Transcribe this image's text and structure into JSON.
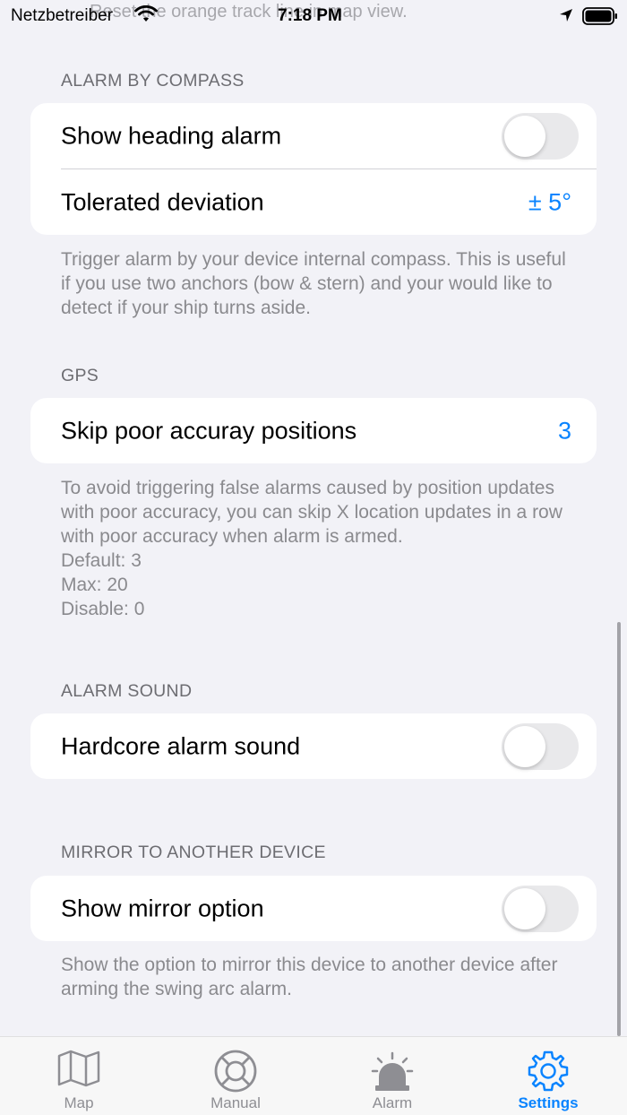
{
  "status_bar": {
    "carrier": "Netzbetreiber",
    "time": "7:18 PM",
    "overlay_text": "Reset the orange track line in map view."
  },
  "sections": {
    "compass": {
      "header": "ALARM BY COMPASS",
      "rows": [
        {
          "label": "Show heading alarm",
          "toggle": false
        },
        {
          "label": "Tolerated deviation",
          "value": "± 5°"
        }
      ],
      "footer": "Trigger alarm by your device internal compass. This is useful if you use two anchors (bow & stern) and your would like to detect if your ship turns aside."
    },
    "gps": {
      "header": "GPS",
      "rows": [
        {
          "label": "Skip poor accuray positions",
          "value": "3"
        }
      ],
      "footer": "To avoid triggering false alarms caused by position updates with poor accuracy, you can skip X location updates in a row with poor accuracy when alarm is armed.\nDefault: 3\nMax: 20\nDisable: 0"
    },
    "sound": {
      "header": "ALARM SOUND",
      "rows": [
        {
          "label": "Hardcore alarm sound",
          "toggle": false
        }
      ]
    },
    "mirror": {
      "header": "MIRROR TO ANOTHER DEVICE",
      "rows": [
        {
          "label": "Show mirror option",
          "toggle": false
        }
      ],
      "footer": "Show the option to mirror this device to another device after arming the swing arc alarm."
    }
  },
  "tab_bar": {
    "tabs": [
      {
        "label": "Map",
        "icon": "map-icon",
        "active": false
      },
      {
        "label": "Manual",
        "icon": "lifebuoy-icon",
        "active": false
      },
      {
        "label": "Alarm",
        "icon": "siren-icon",
        "active": false
      },
      {
        "label": "Settings",
        "icon": "gear-icon",
        "active": true
      }
    ]
  },
  "colors": {
    "accent": "#0a84ff",
    "background": "#f2f2f7",
    "toggle_off": "#e9e9eb"
  }
}
